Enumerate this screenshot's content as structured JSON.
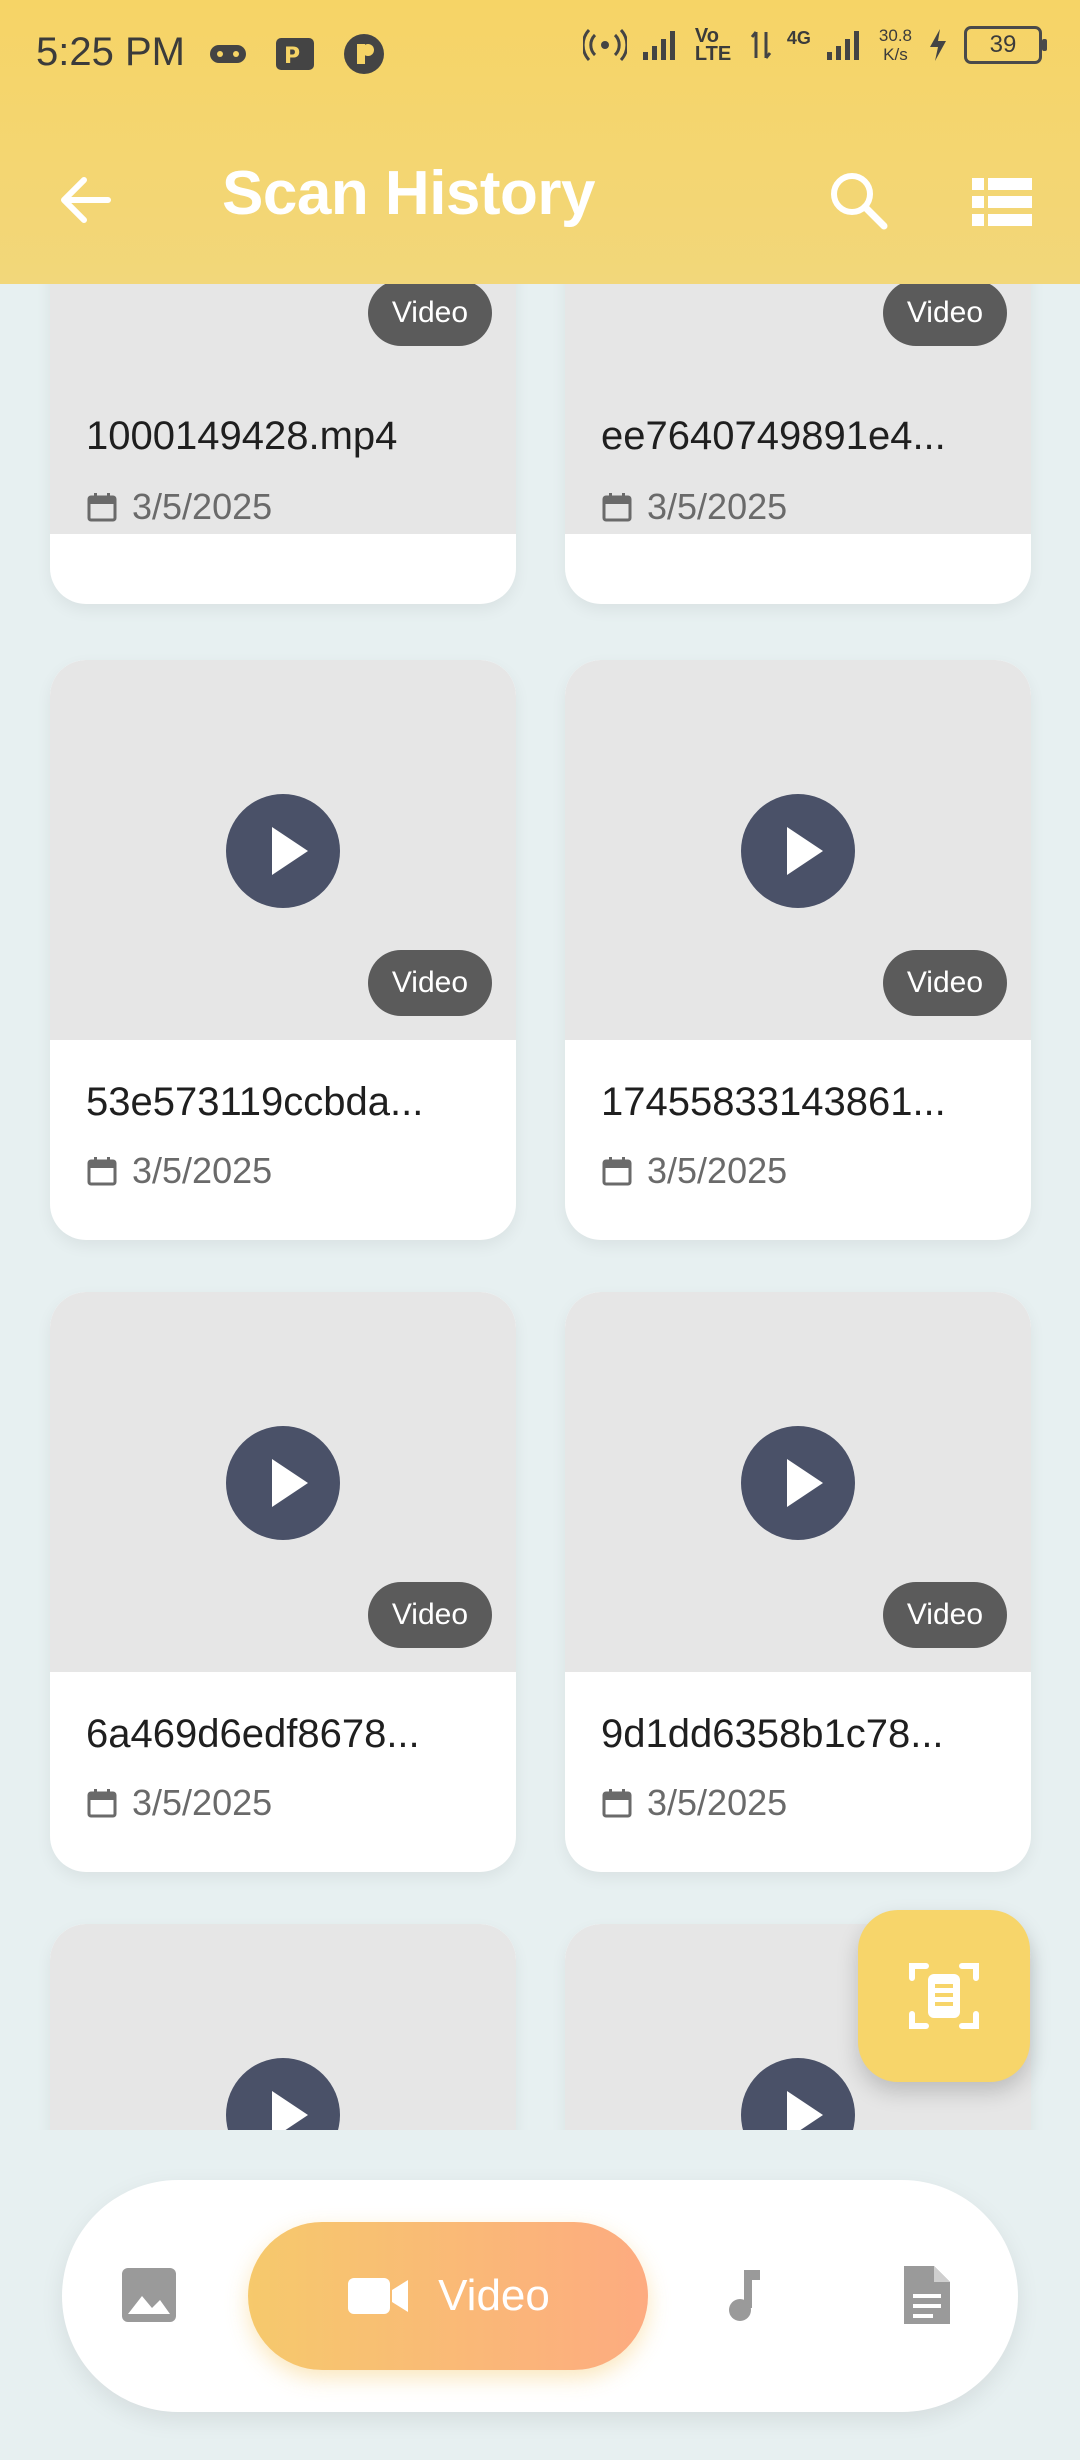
{
  "status_bar": {
    "time": "5:25 PM",
    "network": "30.8\nK/s",
    "network_top": "30.8",
    "network_bottom": "K/s",
    "carrier_1": "Vo LTE",
    "carrier_2": "4G",
    "battery": "39"
  },
  "app_bar": {
    "title": "Scan History",
    "back_icon": "arrow-left-icon",
    "search_icon": "search-icon",
    "list_icon": "list-view-icon"
  },
  "items": [
    {
      "name": "1000149428.mp4",
      "date": "3/5/2025",
      "badge": "Video"
    },
    {
      "name": "ee7640749891e4...",
      "date": "3/5/2025",
      "badge": "Video"
    },
    {
      "name": "53e573119ccbda...",
      "date": "3/5/2025",
      "badge": "Video"
    },
    {
      "name": "17455833143861...",
      "date": "3/5/2025",
      "badge": "Video"
    },
    {
      "name": "6a469d6edf8678...",
      "date": "3/5/2025",
      "badge": "Video"
    },
    {
      "name": "9d1dd6358b1c78...",
      "date": "3/5/2025",
      "badge": "Video"
    },
    {
      "name": "",
      "date": "",
      "badge": ""
    },
    {
      "name": "",
      "date": "",
      "badge": ""
    }
  ],
  "fab": {
    "icon": "scan-document-icon"
  },
  "bottom_nav": {
    "active_label": "Video",
    "tabs": [
      "photo",
      "video",
      "music",
      "document"
    ]
  },
  "colors": {
    "accent": "#f6d466",
    "nav_gradient_start": "#f6c96c",
    "nav_gradient_end": "#fdab80",
    "play_button": "#4a5168",
    "background": "#e7f0f1"
  }
}
